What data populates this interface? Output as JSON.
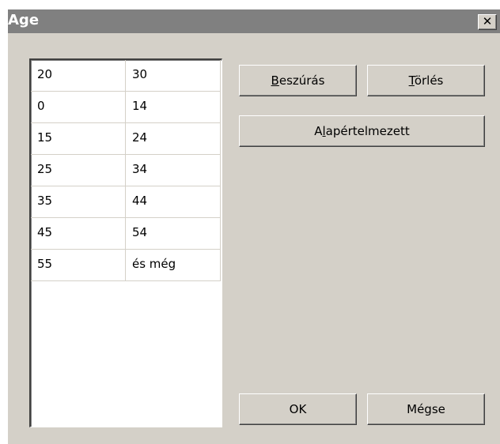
{
  "window": {
    "title": "Age",
    "close_glyph": "✕"
  },
  "table": {
    "rows": [
      [
        "20",
        "30"
      ],
      [
        "0",
        "14"
      ],
      [
        "15",
        "24"
      ],
      [
        "25",
        "34"
      ],
      [
        "35",
        "44"
      ],
      [
        "45",
        "54"
      ],
      [
        "55",
        "és még"
      ]
    ]
  },
  "buttons": {
    "insert": {
      "label": "Beszúrás",
      "mnemonic": "B"
    },
    "delete": {
      "label": "Törlés",
      "mnemonic": "T"
    },
    "default": {
      "label": "Alapértelmezett",
      "mnemonic": "l"
    },
    "ok": {
      "label": "OK"
    },
    "cancel": {
      "label": "Mégse"
    }
  },
  "colors": {
    "face": "#d4d0c8",
    "titlebar": "#808080",
    "title_text": "#ffffff"
  }
}
